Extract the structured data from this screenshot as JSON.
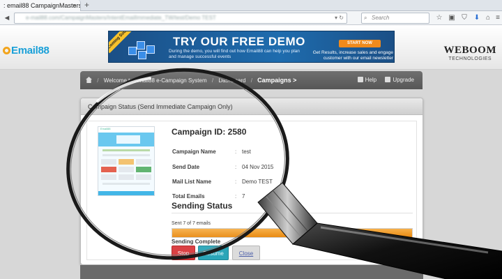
{
  "browser": {
    "tab_title": ": email88 CampaignMasters",
    "tab_close": "×",
    "new_tab": "+",
    "url_blurred": "e-mail88.com/CampaignMasters/IntentEmailImmediate_TW/test/Demo TEST",
    "search_placeholder": "Search"
  },
  "site": {
    "logo_text": "Email88",
    "brand_name": "WEBOOM",
    "brand_sub": "TECHNOLOGIES"
  },
  "banner": {
    "ribbon": "Coming Soon!",
    "title": "TRY OUR FREE DEMO",
    "desc": "During the demo, you will find out how Email88 can help you plan and manage successful events",
    "button": "START NOW",
    "side_text": "Get Results, increase sales and engage customer with our email newsletter"
  },
  "breadcrumb": {
    "items": [
      "Welcome to Email88 e-Campaign System",
      "Dashboard"
    ],
    "current": "Campaigns >",
    "separator": "/",
    "help": "Help",
    "upgrade": "Upgrade"
  },
  "panel": {
    "title": "Campaign Status (Send Immediate Campaign Only)",
    "thumb_header": "Email88",
    "campaign_id": "Campaign ID: 2580",
    "fields": [
      {
        "label": "Campaign Name",
        "value": "test"
      },
      {
        "label": "Send Date",
        "value": "04 Nov 2015"
      },
      {
        "label": "Mail List Name",
        "value": "Demo TEST"
      },
      {
        "label": "Total Emails",
        "value": "7"
      }
    ],
    "colon": ":",
    "sending_title": "Sending Status",
    "sent_text": "Sent 7 of 7 emails",
    "progress": 1.0,
    "complete_text": "Sending Complete",
    "buttons": {
      "stop": "Stop",
      "resume": "Resume",
      "close": "Close"
    }
  },
  "colors": {
    "progress": "#e98a12",
    "stop": "#d9373a",
    "resume": "#2ba5b8",
    "logo": "#1aa0d8"
  },
  "icons": [
    "back-icon",
    "search-icon",
    "star-icon",
    "clipboard-icon",
    "shield-icon",
    "download-icon",
    "home-icon",
    "menu-icon",
    "help-icon",
    "upgrade-icon",
    "magnifying-glass"
  ]
}
